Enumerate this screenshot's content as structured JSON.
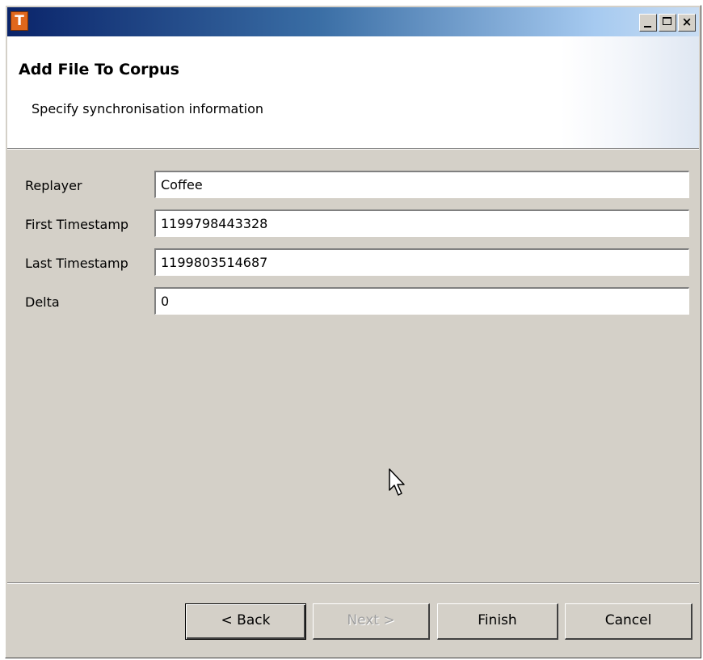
{
  "window": {
    "app_icon_letter": "T",
    "close_glyph": "×"
  },
  "header": {
    "title": "Add File To Corpus",
    "description": "Specify synchronisation information"
  },
  "form": {
    "fields": [
      {
        "label": "Replayer",
        "value": "Coffee"
      },
      {
        "label": "First Timestamp",
        "value": "1199798443328"
      },
      {
        "label": "Last Timestamp",
        "value": "1199803514687"
      },
      {
        "label": "Delta",
        "value": "0"
      }
    ]
  },
  "buttons": {
    "back": "< Back",
    "next": "Next >",
    "finish": "Finish",
    "cancel": "Cancel"
  },
  "icons": {
    "app": "app-logo-icon",
    "minimize": "minimize-icon",
    "maximize": "maximize-icon",
    "close": "close-icon",
    "cursor": "mouse-pointer-icon"
  }
}
